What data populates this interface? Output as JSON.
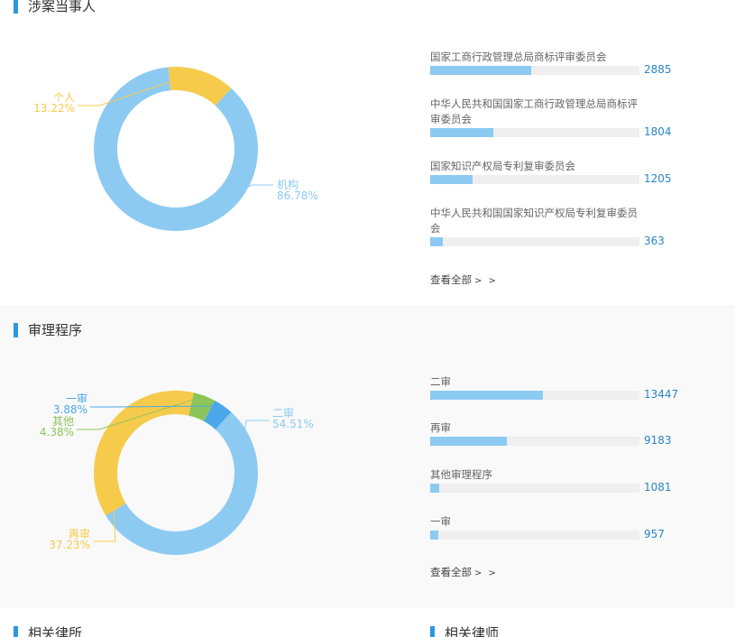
{
  "sections": [
    {
      "title": "涉案当事人",
      "chart_data": {
        "type": "pie",
        "categories": [
          "机构",
          "个人"
        ],
        "values": [
          86.78,
          13.22
        ],
        "value_labels": [
          "86.78%",
          "13.22%"
        ],
        "colors": [
          "#8ccaf2",
          "#f6cb4b"
        ]
      },
      "bar_chart": {
        "type": "bar",
        "categories": [
          "国家工商行政管理总局商标评审委员会",
          "中华人民共和国国家工商行政管理总局商标评审委员会",
          "国家知识产权局专利复审委员会",
          "中华人民共和国国家知识产权局专利复审委员会"
        ],
        "values": [
          2885,
          1804,
          1205,
          363
        ],
        "max": 6000
      },
      "view_all": "查看全部",
      "view_all_arrow": "> >"
    },
    {
      "title": "审理程序",
      "chart_data": {
        "type": "pie",
        "categories": [
          "二审",
          "再审",
          "其他",
          "一审"
        ],
        "values": [
          54.51,
          37.23,
          4.38,
          3.88
        ],
        "value_labels": [
          "54.51%",
          "37.23%",
          "4.38%",
          "3.88%"
        ],
        "colors": [
          "#8ccaf2",
          "#f6cb4b",
          "#8cc55a",
          "#4aa8ea"
        ]
      },
      "bar_chart": {
        "type": "bar",
        "categories": [
          "二审",
          "再审",
          "其他审理程序",
          "一审"
        ],
        "values": [
          13447,
          9183,
          1081,
          957
        ],
        "max": 25000
      },
      "view_all": "查看全部",
      "view_all_arrow": "> >"
    }
  ],
  "bottom_titles": [
    "相关律所",
    "相关律师"
  ]
}
